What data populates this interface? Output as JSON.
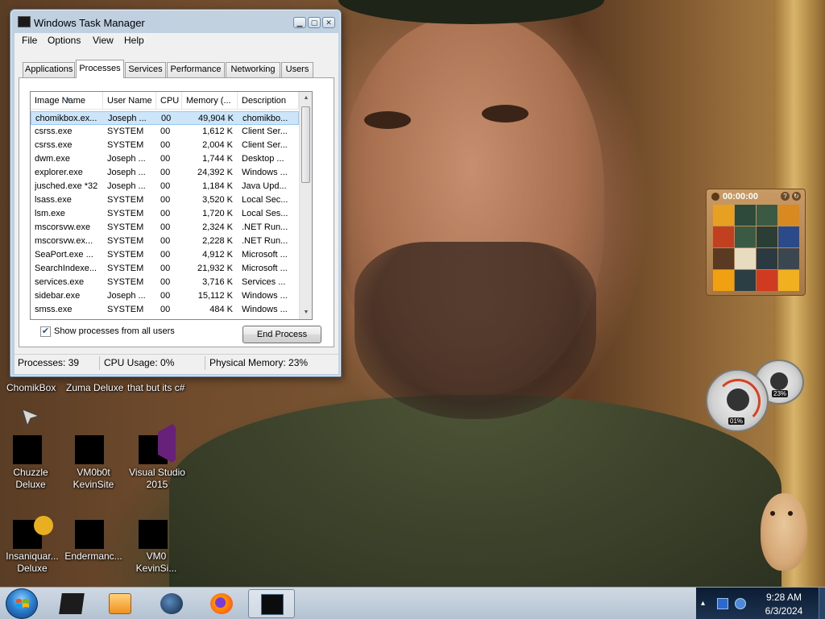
{
  "window": {
    "title": "Windows Task Manager",
    "menu": [
      "File",
      "Options",
      "View",
      "Help"
    ],
    "tabs": [
      "Applications",
      "Processes",
      "Services",
      "Performance",
      "Networking",
      "Users"
    ],
    "active_tab": "Processes",
    "columns": [
      "Image Name",
      "User Name",
      "CPU",
      "Memory (...",
      "Description"
    ],
    "processes": [
      {
        "image": "chomikbox.ex...",
        "user": "Joseph ...",
        "cpu": "00",
        "memory": "49,904 K",
        "description": "chomikbo...",
        "selected": true
      },
      {
        "image": "csrss.exe",
        "user": "SYSTEM",
        "cpu": "00",
        "memory": "1,612 K",
        "description": "Client Ser..."
      },
      {
        "image": "csrss.exe",
        "user": "SYSTEM",
        "cpu": "00",
        "memory": "2,004 K",
        "description": "Client Ser..."
      },
      {
        "image": "dwm.exe",
        "user": "Joseph ...",
        "cpu": "00",
        "memory": "1,744 K",
        "description": "Desktop ..."
      },
      {
        "image": "explorer.exe",
        "user": "Joseph ...",
        "cpu": "00",
        "memory": "24,392 K",
        "description": "Windows ..."
      },
      {
        "image": "jusched.exe *32",
        "user": "Joseph ...",
        "cpu": "00",
        "memory": "1,184 K",
        "description": "Java Upd..."
      },
      {
        "image": "lsass.exe",
        "user": "SYSTEM",
        "cpu": "00",
        "memory": "3,520 K",
        "description": "Local Sec..."
      },
      {
        "image": "lsm.exe",
        "user": "SYSTEM",
        "cpu": "00",
        "memory": "1,720 K",
        "description": "Local Ses..."
      },
      {
        "image": "mscorsvw.exe",
        "user": "SYSTEM",
        "cpu": "00",
        "memory": "2,324 K",
        "description": ".NET Run..."
      },
      {
        "image": "mscorsvw.ex...",
        "user": "SYSTEM",
        "cpu": "00",
        "memory": "2,228 K",
        "description": ".NET Run..."
      },
      {
        "image": "SeaPort.exe ...",
        "user": "SYSTEM",
        "cpu": "00",
        "memory": "4,912 K",
        "description": "Microsoft ..."
      },
      {
        "image": "SearchIndexe...",
        "user": "SYSTEM",
        "cpu": "00",
        "memory": "21,932 K",
        "description": "Microsoft ..."
      },
      {
        "image": "services.exe",
        "user": "SYSTEM",
        "cpu": "00",
        "memory": "3,716 K",
        "description": "Services ..."
      },
      {
        "image": "sidebar.exe",
        "user": "Joseph ...",
        "cpu": "00",
        "memory": "15,112 K",
        "description": "Windows ..."
      },
      {
        "image": "smss.exe",
        "user": "SYSTEM",
        "cpu": "00",
        "memory": "484 K",
        "description": "Windows ..."
      }
    ],
    "show_all_label": "Show processes from all users",
    "show_all_checked": true,
    "end_process_label": "End Process",
    "status": {
      "processes": "Processes: 39",
      "cpu": "CPU Usage: 0%",
      "memory": "Physical Memory: 23%"
    }
  },
  "desktop": {
    "top_labels": [
      "ChomikBox",
      "Zuma Deluxe",
      "that but its c#"
    ],
    "icons": [
      {
        "label_line1": "Chuzzle",
        "label_line2": "Deluxe",
        "icon": "chuzzle-icon"
      },
      {
        "label_line1": "VM0b0t",
        "label_line2": "KevinSite",
        "icon": "vm-icon"
      },
      {
        "label_line1": "Visual Studio",
        "label_line2": "2015",
        "icon": "visual-studio-icon"
      },
      {
        "label_line1": "Insaniquar...",
        "label_line2": "Deluxe",
        "icon": "insaniquarium-icon"
      },
      {
        "label_line1": "Endermanc...",
        "label_line2": "",
        "icon": "console-icon"
      },
      {
        "label_line1": "VM0",
        "label_line2": "KevinSi...",
        "icon": "vm-icon"
      }
    ]
  },
  "gadgets": {
    "puzzle_timer": "00:00:00",
    "cpu_meter": "01%",
    "memory_meter": "23%"
  },
  "taskbar": {
    "apps": [
      "blackbox-icon",
      "media-player-icon",
      "globe-icon",
      "firefox-icon",
      "task-manager-icon"
    ],
    "time": "9:28 AM",
    "date": "6/3/2024",
    "colors": {
      "taskbar": "#c4d1de",
      "tray": "#13263f"
    }
  }
}
